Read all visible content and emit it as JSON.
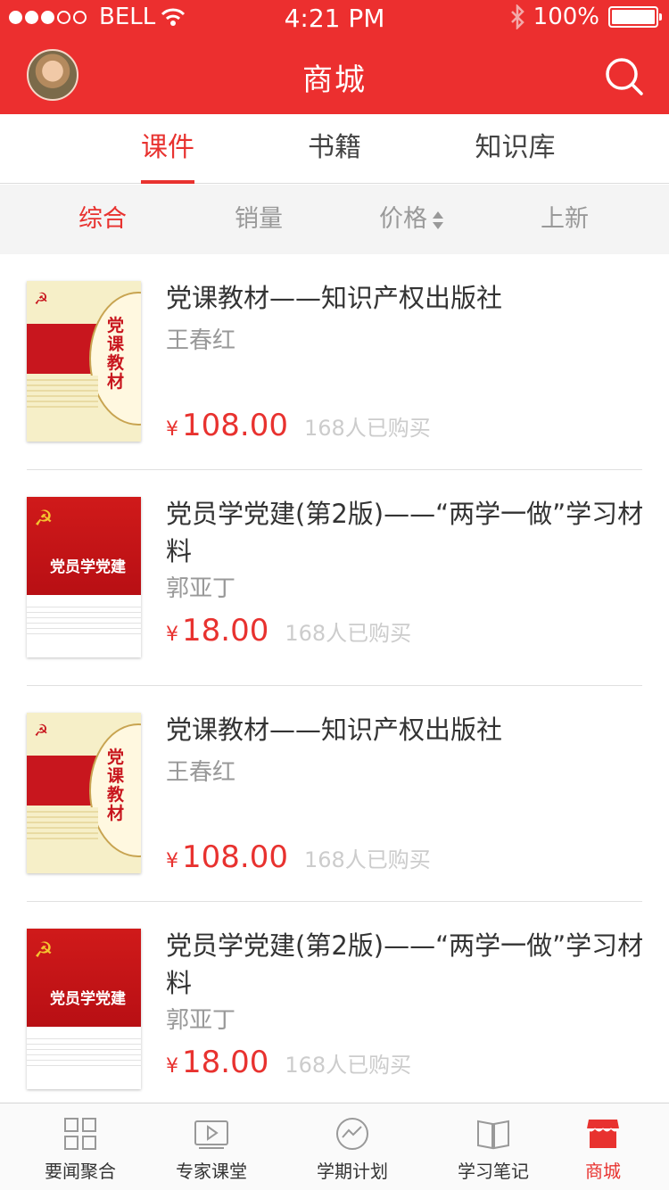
{
  "status_bar": {
    "carrier": "BELL",
    "time": "4:21 PM",
    "battery": "100%"
  },
  "header": {
    "title": "商城"
  },
  "tabs": [
    {
      "label": "课件",
      "active": true
    },
    {
      "label": "书籍",
      "active": false
    },
    {
      "label": "知识库",
      "active": false
    }
  ],
  "sort": [
    {
      "label": "综合",
      "active": true
    },
    {
      "label": "销量",
      "active": false
    },
    {
      "label": "价格",
      "active": false
    },
    {
      "label": "上新",
      "active": false
    }
  ],
  "products": [
    {
      "title": "党课教材——知识产权出版社",
      "author": "王春红",
      "currency": "¥",
      "price": "108.00",
      "sold": "168人已购买",
      "cover": "A"
    },
    {
      "title": "党员学党建(第2版)——“两学一做”学习材料",
      "author": "郭亚丁",
      "currency": "¥",
      "price": "18.00",
      "sold": "168人已购买",
      "cover": "B"
    },
    {
      "title": "党课教材——知识产权出版社",
      "author": "王春红",
      "currency": "¥",
      "price": "108.00",
      "sold": "168人已购买",
      "cover": "A"
    },
    {
      "title": "党员学党建(第2版)——“两学一做”学习材料",
      "author": "郭亚丁",
      "currency": "¥",
      "price": "18.00",
      "sold": "168人已购买",
      "cover": "B"
    }
  ],
  "covers": {
    "A": {
      "vertical_title": "党课教材"
    },
    "B": {
      "title": "党员学党建"
    }
  },
  "tabbar": [
    {
      "label": "要闻聚合",
      "icon": "grid-icon",
      "active": false
    },
    {
      "label": "专家课堂",
      "icon": "video-icon",
      "active": false
    },
    {
      "label": "学期计划",
      "icon": "chart-icon",
      "active": false
    },
    {
      "label": "学习笔记",
      "icon": "book-icon",
      "active": false
    },
    {
      "label": "商城",
      "icon": "store-icon",
      "active": true
    }
  ],
  "colors": {
    "brand_red": "#ec2f2f",
    "accent": "#e8322f"
  }
}
